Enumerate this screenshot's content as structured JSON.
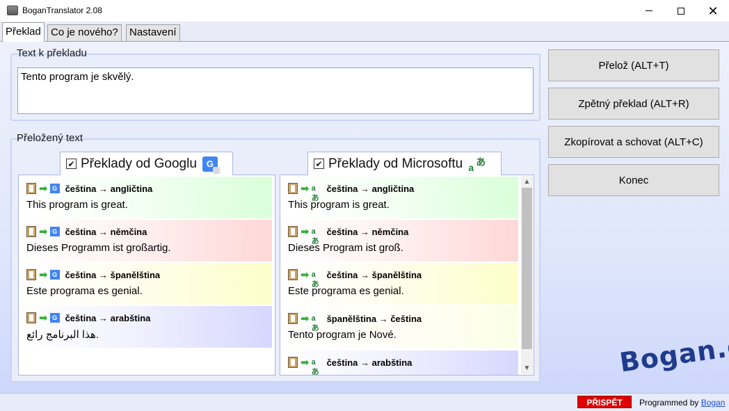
{
  "window": {
    "title": "BoganTranslator 2.08",
    "close_glyph": "✕"
  },
  "tabs": [
    {
      "label": "Překlad",
      "active": true
    },
    {
      "label": "Co je nového?",
      "active": false
    },
    {
      "label": "Nastavení",
      "active": false
    }
  ],
  "source": {
    "group_label": "Text k překladu",
    "text": "Tento program je skvělý."
  },
  "translated": {
    "group_label": "Přeložený text"
  },
  "buttons": {
    "translate": "Přelož (ALT+T)",
    "back_translate": "Zpětný překlad (ALT+R)",
    "copy_hide": "Zkopírovat a schovat (ALT+C)",
    "exit": "Konec"
  },
  "google": {
    "title": "Překlady od Googlu",
    "checked": true,
    "check_glyph": "✔",
    "icon_letter": "G",
    "arrow_glyph": "➡",
    "items": [
      {
        "direction": "čeština → angličtina",
        "text": "This program is great.",
        "color": "green"
      },
      {
        "direction": "čeština → němčina",
        "text": "Dieses Programm ist großartig.",
        "color": "red"
      },
      {
        "direction": "čeština → španělština",
        "text": "Este programa es genial.",
        "color": "yellow"
      },
      {
        "direction": "čeština → arabština",
        "text": "هذا البرنامج رائع.",
        "color": "blue"
      }
    ]
  },
  "microsoft": {
    "title": "Překlady od Microsoftu",
    "checked": true,
    "check_glyph": "✔",
    "icon_glyph_1": "a",
    "icon_glyph_2": "あ",
    "mini_icon_glyph": "aあ",
    "arrow_glyph": "➡",
    "items": [
      {
        "direction": "čeština → angličtina",
        "text": "This program is great.",
        "color": "green"
      },
      {
        "direction": "čeština → němčina",
        "text": "Dieses Program ist groß.",
        "color": "red"
      },
      {
        "direction": "čeština → španělština",
        "text": "Este programa es genial.",
        "color": "yellow"
      },
      {
        "direction": "španělština → čeština",
        "text": "Tento program je Nové.",
        "color": "cream"
      },
      {
        "direction": "čeština → arabština",
        "text": "",
        "color": "blue"
      }
    ],
    "scroll_up_glyph": "▲",
    "scroll_down_glyph": "▼"
  },
  "brand": "Bogan.cz",
  "status": {
    "donate_label": "PŘISPĚT",
    "programmed_by": "Programmed by ",
    "author_link": "Bogan"
  }
}
